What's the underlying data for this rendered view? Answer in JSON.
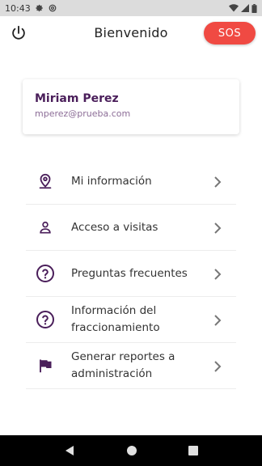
{
  "status_bar": {
    "time": "10:43",
    "icons": [
      "settings-icon",
      "at-sign-icon",
      "wifi-icon",
      "signal-icon",
      "battery-icon"
    ]
  },
  "header": {
    "title": "Bienvenido",
    "sos_label": "SOS",
    "sos_color": "#f04a43",
    "power_icon": "power-icon"
  },
  "profile": {
    "name": "Miriam Perez",
    "email": "mperez@prueba.com"
  },
  "menu": {
    "items": [
      {
        "label": "Mi información",
        "icon": "location-pin-icon"
      },
      {
        "label": "Acceso a visitas",
        "icon": "person-icon"
      },
      {
        "label": "Preguntas frecuentes",
        "icon": "help-circle-icon"
      },
      {
        "label": "Información del fraccionamiento",
        "icon": "help-circle-icon"
      },
      {
        "label": "Generar reportes a administración",
        "icon": "flag-icon"
      }
    ]
  },
  "colors": {
    "accent": "#4a1e5a",
    "icon": "#4a1e5a",
    "sos": "#f04a43"
  },
  "nav_bar": {
    "icons": [
      "back-icon",
      "home-icon",
      "recents-icon"
    ]
  }
}
